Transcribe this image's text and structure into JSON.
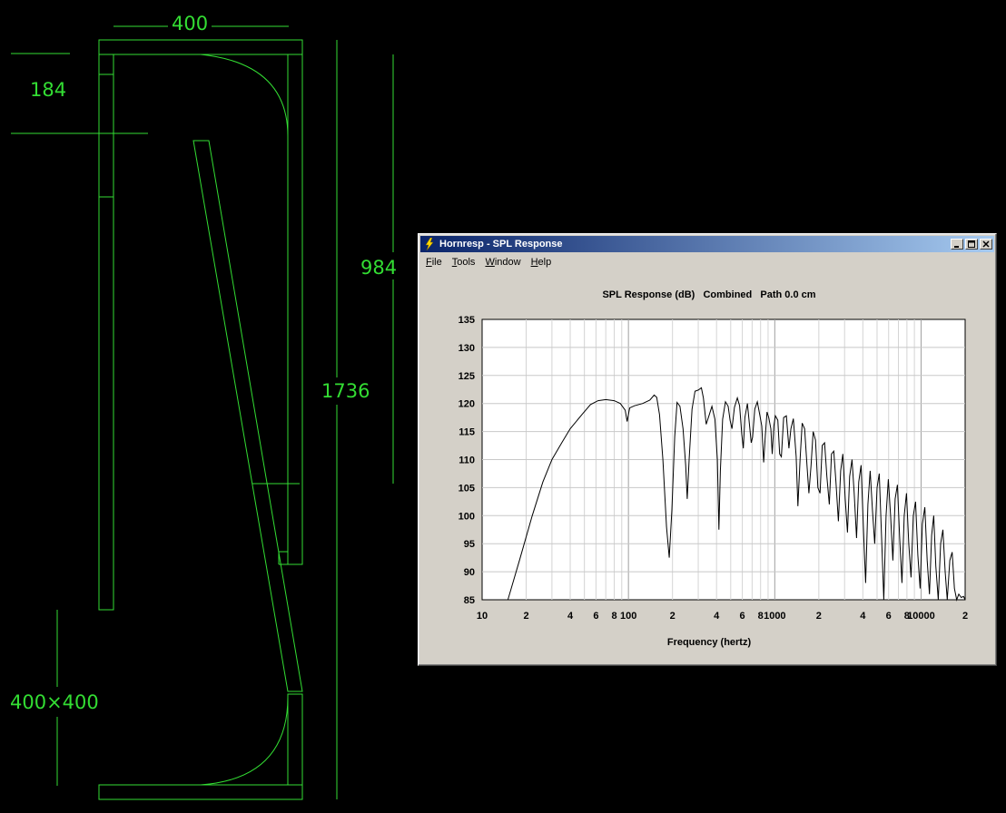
{
  "cad_drawing": {
    "dim_width": "400",
    "dim_top_offset": "184",
    "dim_inner_height": "984",
    "dim_total_height": "1736",
    "dim_mouth": "400×400",
    "line_color": "#33dd33"
  },
  "window": {
    "title": "Hornresp - SPL Response",
    "app_icon": "lightning-bolt-icon",
    "menu": [
      {
        "first": "F",
        "rest": "ile"
      },
      {
        "first": "T",
        "rest": "ools"
      },
      {
        "first": "W",
        "rest": "indow"
      },
      {
        "first": "H",
        "rest": "elp"
      }
    ],
    "controls": [
      "minimize-icon",
      "maximize-icon",
      "close-icon"
    ]
  },
  "chart_data": {
    "type": "line",
    "title": "SPL Response (dB)   Combined   Path 0.0 cm",
    "xlabel": "Frequency (hertz)",
    "ylabel": "",
    "xscale": "log",
    "xlim": [
      10,
      20000
    ],
    "ylim": [
      85,
      135
    ],
    "x_tick_labels": [
      {
        "value": 10,
        "label": "10"
      },
      {
        "value": 20,
        "label": "2"
      },
      {
        "value": 40,
        "label": "4"
      },
      {
        "value": 60,
        "label": "6"
      },
      {
        "value": 80,
        "label": "8"
      },
      {
        "value": 100,
        "label": "100"
      },
      {
        "value": 200,
        "label": "2"
      },
      {
        "value": 400,
        "label": "4"
      },
      {
        "value": 600,
        "label": "6"
      },
      {
        "value": 800,
        "label": "8"
      },
      {
        "value": 1000,
        "label": "1000"
      },
      {
        "value": 2000,
        "label": "2"
      },
      {
        "value": 4000,
        "label": "4"
      },
      {
        "value": 6000,
        "label": "6"
      },
      {
        "value": 8000,
        "label": "8"
      },
      {
        "value": 10000,
        "label": "10000"
      },
      {
        "value": 20000,
        "label": "2"
      }
    ],
    "y_ticks": [
      85,
      90,
      95,
      100,
      105,
      110,
      115,
      120,
      125,
      130,
      135
    ],
    "grid": true,
    "series": [
      {
        "values": [
          [
            15,
            85
          ],
          [
            18,
            92
          ],
          [
            22,
            100
          ],
          [
            26,
            106
          ],
          [
            30,
            110
          ],
          [
            35,
            113
          ],
          [
            40,
            115.5
          ],
          [
            48,
            118
          ],
          [
            55,
            119.8
          ],
          [
            62,
            120.5
          ],
          [
            70,
            120.7
          ],
          [
            80,
            120.5
          ],
          [
            88,
            120
          ],
          [
            95,
            118.8
          ],
          [
            98,
            116.8
          ],
          [
            102,
            119.2
          ],
          [
            110,
            119.6
          ],
          [
            125,
            120
          ],
          [
            140,
            120.6
          ],
          [
            150,
            121.5
          ],
          [
            156,
            121.1
          ],
          [
            163,
            118
          ],
          [
            172,
            110
          ],
          [
            182,
            98
          ],
          [
            190,
            92.5
          ],
          [
            198,
            101
          ],
          [
            207,
            114
          ],
          [
            215,
            120.2
          ],
          [
            225,
            119.5
          ],
          [
            236,
            115.5
          ],
          [
            246,
            109
          ],
          [
            252,
            103
          ],
          [
            260,
            110
          ],
          [
            272,
            119
          ],
          [
            285,
            122.2
          ],
          [
            300,
            122.4
          ],
          [
            315,
            122.8
          ],
          [
            325,
            121
          ],
          [
            340,
            116.3
          ],
          [
            355,
            117.8
          ],
          [
            372,
            119.5
          ],
          [
            390,
            117.2
          ],
          [
            405,
            110
          ],
          [
            415,
            97.5
          ],
          [
            425,
            108
          ],
          [
            440,
            117.2
          ],
          [
            460,
            120.3
          ],
          [
            480,
            119.5
          ],
          [
            495,
            117
          ],
          [
            510,
            115.5
          ],
          [
            530,
            119.3
          ],
          [
            555,
            121
          ],
          [
            575,
            119.6
          ],
          [
            595,
            114.5
          ],
          [
            610,
            112
          ],
          [
            625,
            117.5
          ],
          [
            650,
            120
          ],
          [
            670,
            116.5
          ],
          [
            690,
            113
          ],
          [
            705,
            114
          ],
          [
            730,
            119
          ],
          [
            760,
            120.3
          ],
          [
            790,
            118
          ],
          [
            815,
            116
          ],
          [
            840,
            109.5
          ],
          [
            860,
            114
          ],
          [
            885,
            118.5
          ],
          [
            910,
            117.5
          ],
          [
            940,
            115.5
          ],
          [
            960,
            111
          ],
          [
            985,
            116
          ],
          [
            1010,
            117.8
          ],
          [
            1050,
            117
          ],
          [
            1080,
            111
          ],
          [
            1110,
            110.5
          ],
          [
            1150,
            117.5
          ],
          [
            1200,
            117.8
          ],
          [
            1250,
            112
          ],
          [
            1290,
            115.5
          ],
          [
            1340,
            117.3
          ],
          [
            1400,
            110.5
          ],
          [
            1440,
            101.7
          ],
          [
            1490,
            110
          ],
          [
            1540,
            116.5
          ],
          [
            1600,
            115.5
          ],
          [
            1660,
            109
          ],
          [
            1710,
            104
          ],
          [
            1770,
            109
          ],
          [
            1830,
            115
          ],
          [
            1900,
            113.5
          ],
          [
            1970,
            105
          ],
          [
            2040,
            104
          ],
          [
            2110,
            112.5
          ],
          [
            2190,
            113
          ],
          [
            2270,
            107
          ],
          [
            2360,
            102
          ],
          [
            2440,
            111
          ],
          [
            2530,
            111.5
          ],
          [
            2620,
            106
          ],
          [
            2720,
            99
          ],
          [
            2820,
            108
          ],
          [
            2920,
            111
          ],
          [
            3030,
            103
          ],
          [
            3140,
            97
          ],
          [
            3250,
            107
          ],
          [
            3370,
            110
          ],
          [
            3490,
            104
          ],
          [
            3620,
            96
          ],
          [
            3750,
            106
          ],
          [
            3890,
            109
          ],
          [
            4030,
            98
          ],
          [
            4180,
            88
          ],
          [
            4330,
            102
          ],
          [
            4490,
            108
          ],
          [
            4650,
            101
          ],
          [
            4820,
            95
          ],
          [
            5000,
            105
          ],
          [
            5180,
            107.5
          ],
          [
            5370,
            96
          ],
          [
            5560,
            85
          ],
          [
            5760,
            100
          ],
          [
            5970,
            106.5
          ],
          [
            6190,
            100
          ],
          [
            6410,
            92
          ],
          [
            6650,
            103
          ],
          [
            6890,
            105.5
          ],
          [
            7140,
            96
          ],
          [
            7400,
            88
          ],
          [
            7670,
            100
          ],
          [
            7950,
            104
          ],
          [
            8240,
            95
          ],
          [
            8540,
            89
          ],
          [
            8850,
            100
          ],
          [
            9170,
            102.5
          ],
          [
            9500,
            93
          ],
          [
            9850,
            87
          ],
          [
            10200,
            98.5
          ],
          [
            10600,
            101.5
          ],
          [
            11000,
            92
          ],
          [
            11400,
            86
          ],
          [
            11800,
            96.5
          ],
          [
            12200,
            100
          ],
          [
            12600,
            91
          ],
          [
            13100,
            85
          ],
          [
            13600,
            95
          ],
          [
            14100,
            97.5
          ],
          [
            14600,
            90
          ],
          [
            15100,
            85
          ],
          [
            15700,
            92
          ],
          [
            16300,
            93.5
          ],
          [
            16900,
            87
          ],
          [
            17500,
            85
          ],
          [
            18100,
            86
          ],
          [
            18800,
            85.4
          ],
          [
            19500,
            85.6
          ],
          [
            20000,
            85
          ]
        ]
      }
    ]
  }
}
